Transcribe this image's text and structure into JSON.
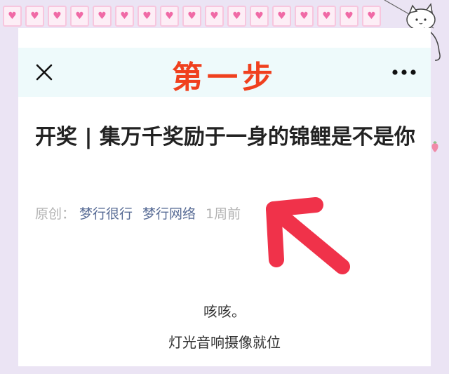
{
  "header": {
    "step_title": "第一步"
  },
  "article": {
    "title": "开奖 | 集万千奖励于一身的锦鲤是不是你",
    "meta": {
      "label": "原创：",
      "author": "梦行很行",
      "account": "梦行网络",
      "time": "1周前"
    },
    "body": [
      "咳咳。",
      "灯光音响摄像就位"
    ]
  },
  "decor": {
    "heart_glyph": "♥",
    "accent_color": "#f0401e",
    "link_color": "#576b95",
    "heart_color": "#f06aa6"
  }
}
